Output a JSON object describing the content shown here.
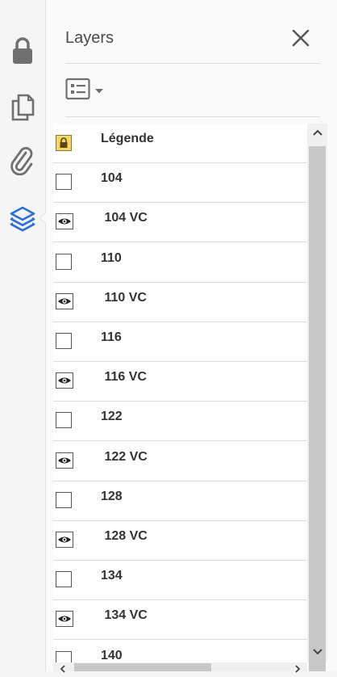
{
  "panel": {
    "title": "Layers"
  },
  "layers": [
    {
      "label": "Légende",
      "icon": "lock-icon"
    },
    {
      "label": "104",
      "icon": "checkbox"
    },
    {
      "label": " 104 VC",
      "icon": "eye-icon"
    },
    {
      "label": "110",
      "icon": "checkbox"
    },
    {
      "label": " 110 VC",
      "icon": "eye-icon"
    },
    {
      "label": "116",
      "icon": "checkbox"
    },
    {
      "label": " 116 VC",
      "icon": "eye-icon"
    },
    {
      "label": "122",
      "icon": "checkbox"
    },
    {
      "label": " 122 VC",
      "icon": "eye-icon"
    },
    {
      "label": "128",
      "icon": "checkbox"
    },
    {
      "label": " 128 VC",
      "icon": "eye-icon"
    },
    {
      "label": "134",
      "icon": "checkbox"
    },
    {
      "label": " 134 VC",
      "icon": "eye-icon"
    },
    {
      "label": "140",
      "icon": "checkbox"
    }
  ],
  "rail": {
    "tools": [
      "lock-icon",
      "pages-icon",
      "attachment-icon",
      "layers-icon"
    ],
    "active": "layers-icon"
  },
  "colors": {
    "active_accent": "#2a6fd6",
    "icon_gray": "#6f6f6f"
  }
}
